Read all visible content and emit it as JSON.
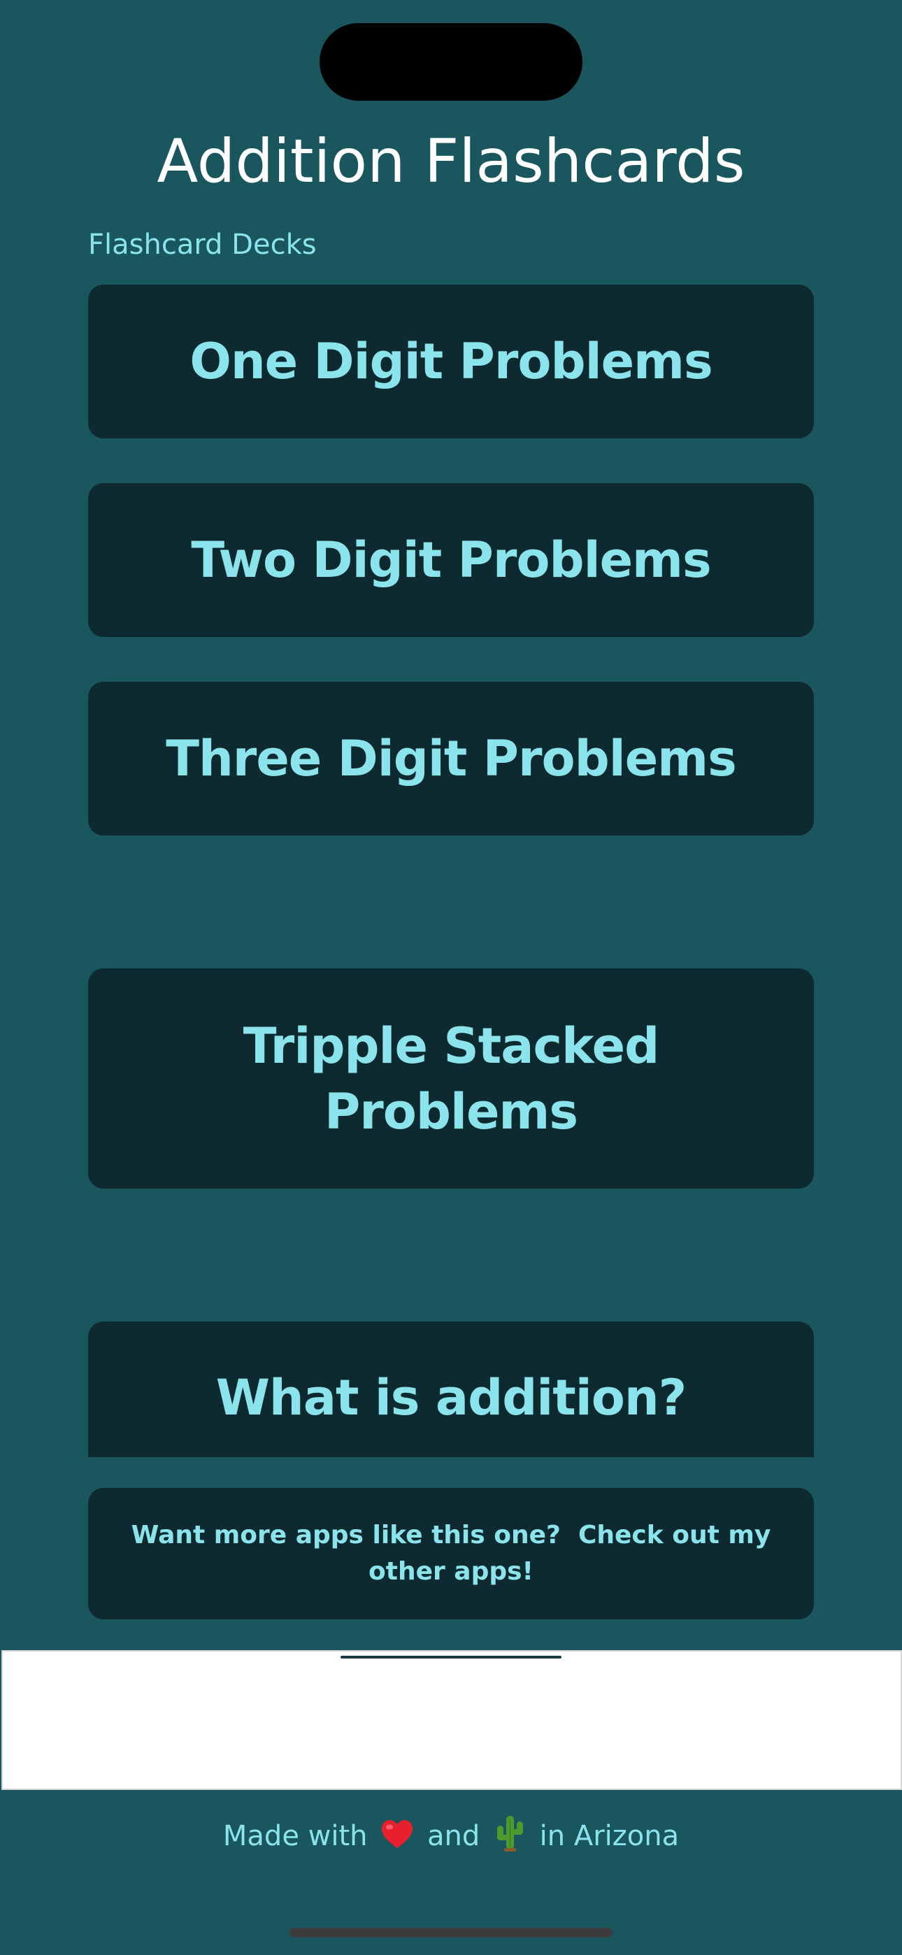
{
  "header": {
    "title": "Addition Flashcards"
  },
  "decks": {
    "section_label": "Flashcard Decks",
    "items": [
      {
        "label": "One Digit Problems"
      },
      {
        "label": "Two Digit Problems"
      },
      {
        "label": "Three Digit Problems"
      },
      {
        "label": "Tripple Stacked Problems"
      },
      {
        "label": "What is addition?"
      }
    ]
  },
  "promo": {
    "label": "Want more apps like this one?  Check out my other apps!"
  },
  "footer": {
    "text_before": "Made with",
    "text_middle": "and",
    "text_after": "in Arizona",
    "heart_icon": "heart-icon",
    "cactus_icon": "cactus-icon"
  },
  "colors": {
    "background": "#1a565e",
    "button_bg": "#0c2a2f",
    "accent_text": "#8be3ec",
    "title_text": "#ffffff"
  }
}
